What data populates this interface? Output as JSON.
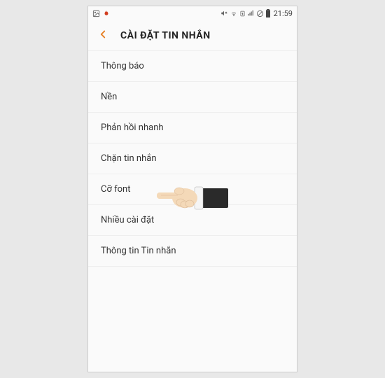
{
  "status_bar": {
    "time": "21:59"
  },
  "header": {
    "title": "CÀI ĐẶT TIN NHẮN"
  },
  "settings": {
    "items": [
      {
        "label": "Thông báo"
      },
      {
        "label": "Nền"
      },
      {
        "label": "Phản hồi nhanh"
      },
      {
        "label": "Chặn tin nhắn"
      },
      {
        "label": "Cỡ font"
      },
      {
        "label": "Nhiều cài đặt"
      },
      {
        "label": "Thông tin Tin nhắn"
      }
    ]
  }
}
